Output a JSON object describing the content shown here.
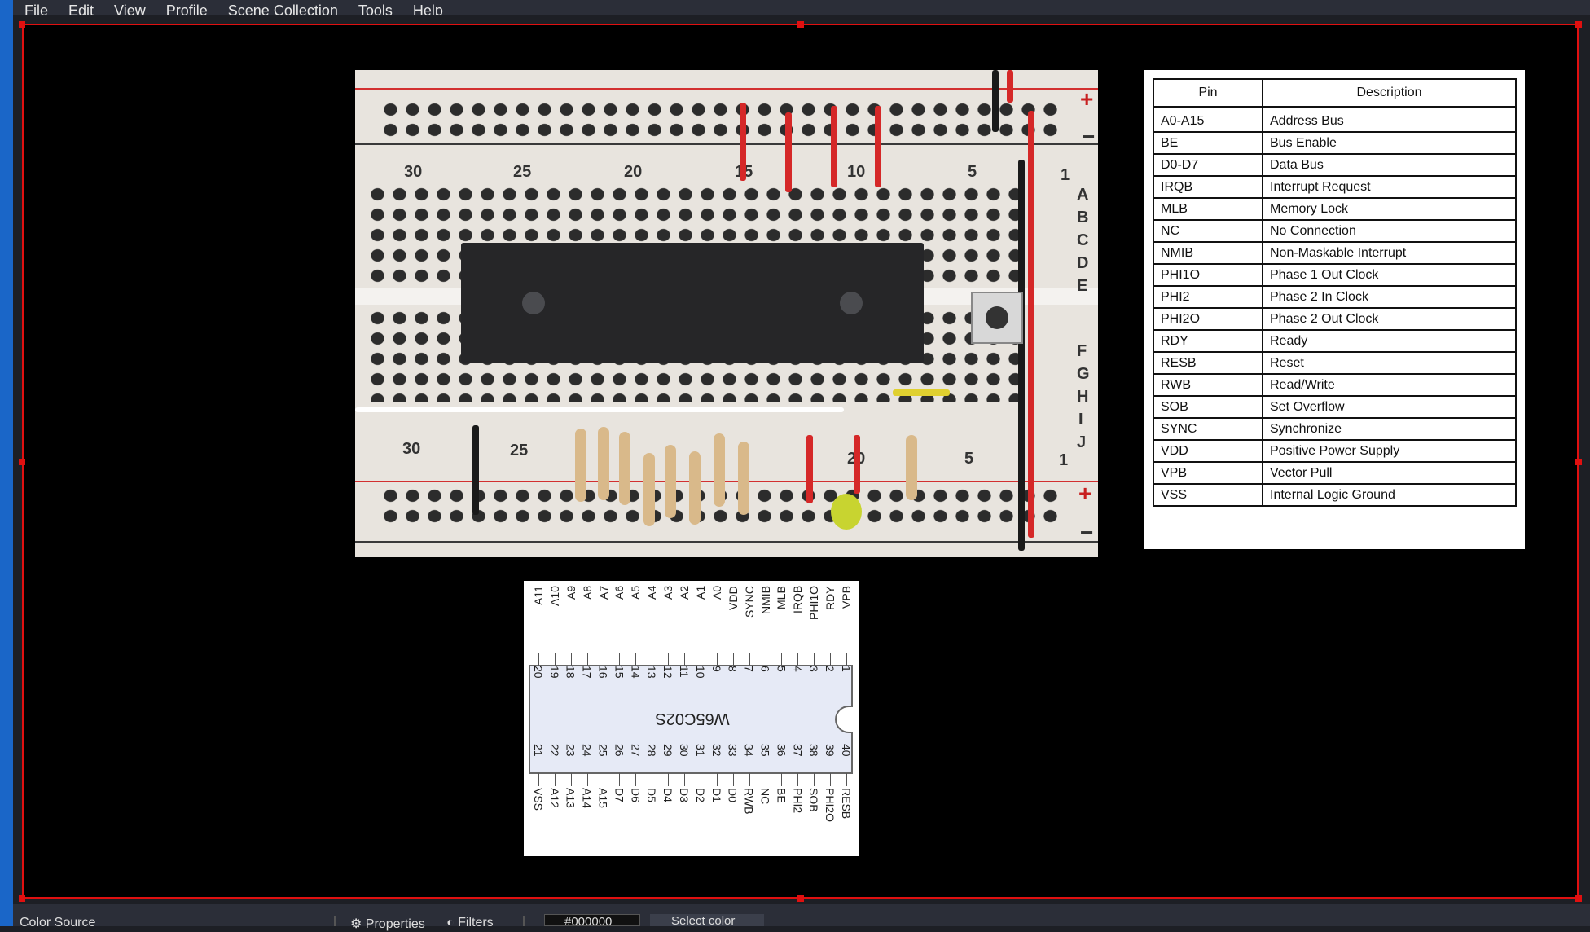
{
  "menu": [
    "File",
    "Edit",
    "View",
    "Profile",
    "Scene Collection",
    "Tools",
    "Help"
  ],
  "breadboard": {
    "top_numbers": [
      "30",
      "25",
      "20",
      "15",
      "10",
      "5",
      "1"
    ],
    "bottom_numbers": [
      "30",
      "25",
      "20",
      "5",
      "1"
    ],
    "rows_top": [
      "A",
      "B",
      "C",
      "D",
      "E"
    ],
    "rows_bottom": [
      "F",
      "G",
      "H",
      "I",
      "J"
    ],
    "rail_plus": "+",
    "rail_minus": "−"
  },
  "pin_table": {
    "headers": [
      "Pin",
      "Description"
    ],
    "rows": [
      [
        "A0-A15",
        "Address Bus"
      ],
      [
        "BE",
        "Bus Enable"
      ],
      [
        "D0-D7",
        "Data Bus"
      ],
      [
        "IRQB",
        "Interrupt Request"
      ],
      [
        "MLB",
        "Memory Lock"
      ],
      [
        "NC",
        "No Connection"
      ],
      [
        "NMIB",
        "Non-Maskable Interrupt"
      ],
      [
        "PHI1O",
        "Phase 1 Out Clock"
      ],
      [
        "PHI2",
        "Phase 2 In Clock"
      ],
      [
        "PHI2O",
        "Phase 2 Out Clock"
      ],
      [
        "RDY",
        "Ready"
      ],
      [
        "RESB",
        "Reset"
      ],
      [
        "RWB",
        "Read/Write"
      ],
      [
        "SOB",
        "Set Overflow"
      ],
      [
        "SYNC",
        "Synchronize"
      ],
      [
        "VDD",
        "Positive Power Supply"
      ],
      [
        "VPB",
        "Vector Pull"
      ],
      [
        "VSS",
        "Internal Logic Ground"
      ]
    ]
  },
  "chip": {
    "name": "W65C02S",
    "top_pins": [
      {
        "num": "1",
        "label": "VPB"
      },
      {
        "num": "2",
        "label": "RDY"
      },
      {
        "num": "3",
        "label": "PHI1O"
      },
      {
        "num": "4",
        "label": "IRQB"
      },
      {
        "num": "5",
        "label": "MLB"
      },
      {
        "num": "6",
        "label": "NMIB"
      },
      {
        "num": "7",
        "label": "SYNC"
      },
      {
        "num": "8",
        "label": "VDD"
      },
      {
        "num": "9",
        "label": "A0"
      },
      {
        "num": "10",
        "label": "A1"
      },
      {
        "num": "11",
        "label": "A2"
      },
      {
        "num": "12",
        "label": "A3"
      },
      {
        "num": "13",
        "label": "A4"
      },
      {
        "num": "14",
        "label": "A5"
      },
      {
        "num": "15",
        "label": "A6"
      },
      {
        "num": "16",
        "label": "A7"
      },
      {
        "num": "17",
        "label": "A8"
      },
      {
        "num": "18",
        "label": "A9"
      },
      {
        "num": "19",
        "label": "A10"
      },
      {
        "num": "20",
        "label": "A11"
      }
    ],
    "bottom_pins": [
      {
        "num": "40",
        "label": "RESB"
      },
      {
        "num": "39",
        "label": "PHI2O"
      },
      {
        "num": "38",
        "label": "SOB"
      },
      {
        "num": "37",
        "label": "PHI2"
      },
      {
        "num": "36",
        "label": "BE"
      },
      {
        "num": "35",
        "label": "NC"
      },
      {
        "num": "34",
        "label": "RWB"
      },
      {
        "num": "33",
        "label": "D0"
      },
      {
        "num": "32",
        "label": "D1"
      },
      {
        "num": "31",
        "label": "D2"
      },
      {
        "num": "30",
        "label": "D3"
      },
      {
        "num": "29",
        "label": "D4"
      },
      {
        "num": "28",
        "label": "D5"
      },
      {
        "num": "27",
        "label": "D6"
      },
      {
        "num": "26",
        "label": "D7"
      },
      {
        "num": "25",
        "label": "A15"
      },
      {
        "num": "24",
        "label": "A14"
      },
      {
        "num": "23",
        "label": "A13"
      },
      {
        "num": "22",
        "label": "A12"
      },
      {
        "num": "21",
        "label": "VSS"
      }
    ]
  },
  "statusbar": {
    "source_label": "Color Source",
    "properties_label": "Properties",
    "filters_label": "Filters",
    "color_value": "#000000",
    "select_color_label": "Select color"
  },
  "colors": {
    "selection": "#e01010",
    "wire_red": "#d52828",
    "wire_black": "#1a1a1a",
    "wire_yellow": "#e0d030"
  }
}
